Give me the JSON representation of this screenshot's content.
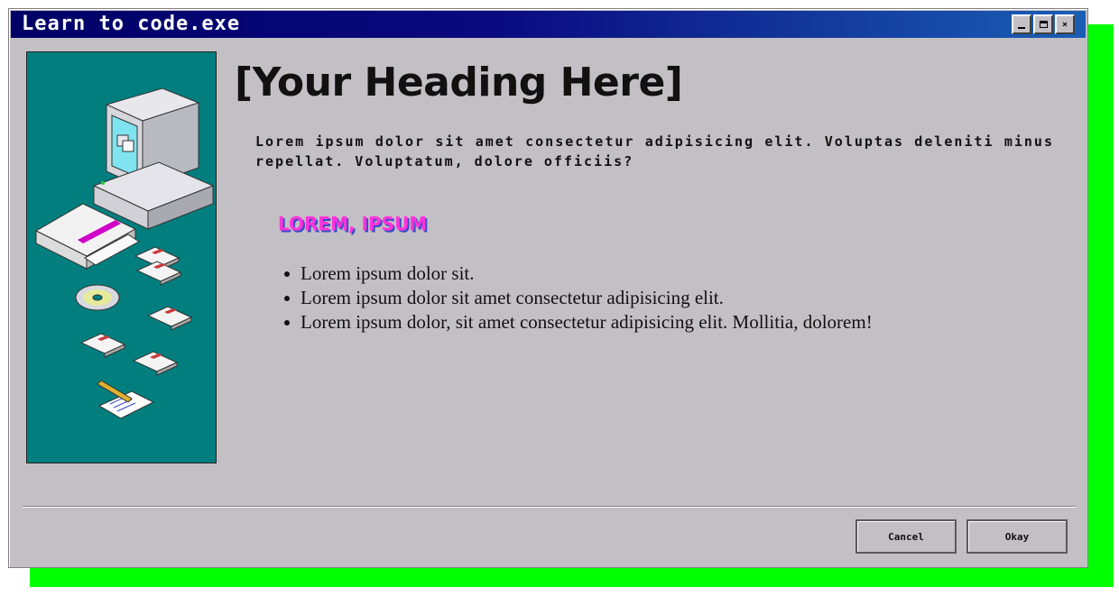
{
  "window": {
    "title": "Learn to code.exe",
    "controls": {
      "minimize": "minimize-icon",
      "maximize": "maximize-icon",
      "close": "×"
    }
  },
  "content": {
    "heading": "[Your Heading Here]",
    "intro": "Lorem ipsum dolor sit amet consectetur adipisicing elit. Voluptas deleniti minus repellat. Voluptatum, dolore officiis?",
    "subheading": "LOREM, IPSUM",
    "items": [
      "Lorem ipsum dolor sit.",
      "Lorem ipsum dolor sit amet consectetur adipisicing elit.",
      "Lorem ipsum dolor, sit amet consectetur adipisicing elit. Mollitia, dolorem!"
    ]
  },
  "footer": {
    "cancel_label": "Cancel",
    "okay_label": "Okay"
  },
  "colors": {
    "shadow": "#00ff00",
    "titlebar_start": "#000066",
    "titlebar_end": "#1a5fb4",
    "window_bg": "#c3c0c5",
    "art_bg": "#037e7e",
    "subheading": "#ff33dd"
  }
}
